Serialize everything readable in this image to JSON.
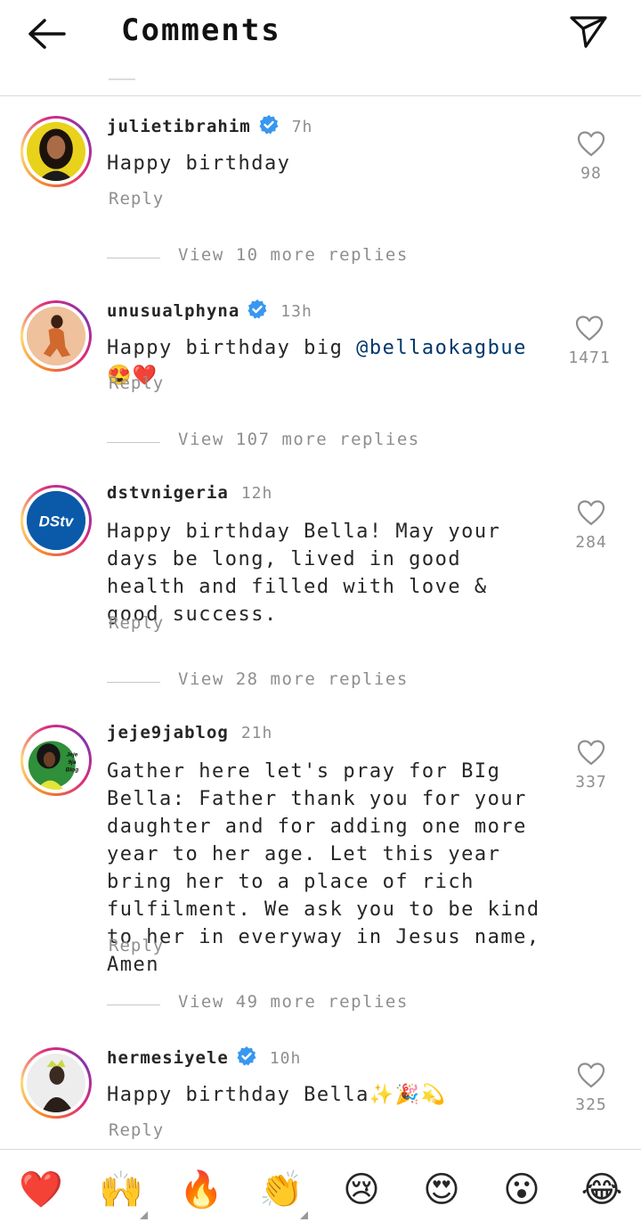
{
  "header": {
    "title": "Comments",
    "back_icon": "arrow-left-icon",
    "send_icon": "paper-plane-icon"
  },
  "colors": {
    "verified": "#3897f0",
    "mention": "#00376b",
    "secondary_text": "#8e8e8e",
    "heart_red": "#ed4956"
  },
  "comments": [
    {
      "username": "julietibrahim",
      "verified": true,
      "time": "7h",
      "text": "Happy birthday",
      "reply_label": "Reply",
      "likes": "98",
      "view_more": "View 10 more replies"
    },
    {
      "username": "unusualphyna",
      "verified": true,
      "time": "13h",
      "text_prefix": "Happy birthday big ",
      "mention": "@bellaokagbue",
      "text_suffix": " 😍❤️",
      "reply_label": "Reply",
      "likes": "1471",
      "view_more": "View 107 more replies"
    },
    {
      "username": "dstvnigeria",
      "verified": false,
      "time": "12h",
      "text": "Happy birthday Bella! May your days be long, lived in good health and filled with love & good success.",
      "reply_label": "Reply",
      "likes": "284",
      "avatar_label": "DStv",
      "view_more": "View 28 more replies"
    },
    {
      "username": "jeje9jablog",
      "verified": false,
      "time": "21h",
      "text": "Gather here let's pray for BIg Bella: Father thank you for your daughter and for adding one more year to her age. Let this year bring her to a place of rich fulfilment. We ask you to be kind to her in everyway in Jesus name, Amen",
      "reply_label": "Reply",
      "likes": "337",
      "avatar_label": "Jeje 9ja Blog",
      "view_more": "View 49 more replies"
    },
    {
      "username": "hermesiyele",
      "verified": true,
      "time": "10h",
      "text": "Happy birthday Bella✨🎉💫",
      "reply_label": "Reply",
      "likes": "325"
    }
  ],
  "emoji_bar": [
    "❤️",
    "🙌",
    "🔥",
    "👏",
    "😢",
    "😍",
    "😮",
    "😂"
  ]
}
